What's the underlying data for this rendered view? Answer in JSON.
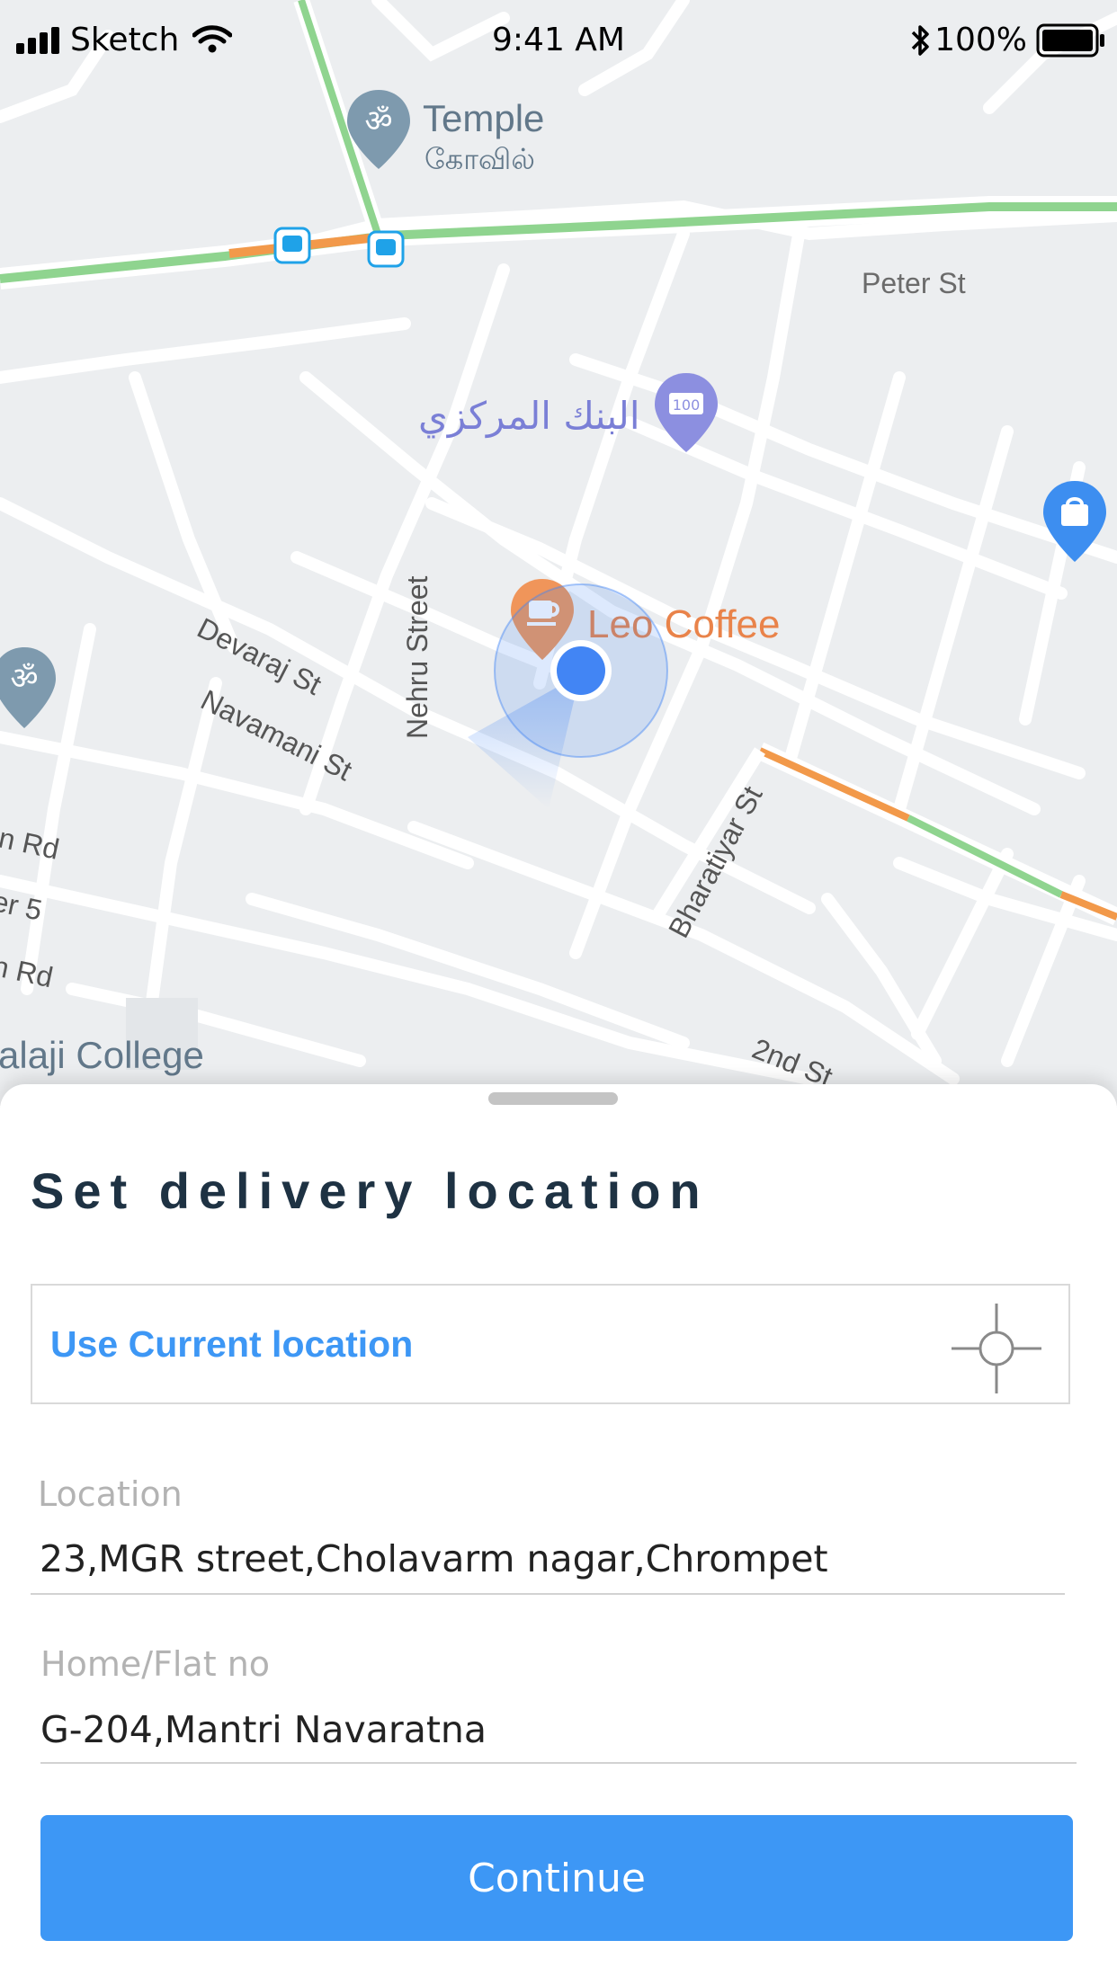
{
  "status_bar": {
    "carrier": "Sketch",
    "time": "9:41 AM",
    "battery": "100%"
  },
  "map": {
    "labels": {
      "temple": "Temple",
      "temple_tamil": "கோவில்",
      "peter_st": "Peter St",
      "central_bank": "البنك المركزي",
      "leo_coffee": "Leo Coffee",
      "devaraj_st": "Devaraj St",
      "navamani_st": "Navamani St",
      "nehru_street": "Nehru Street",
      "bharatiyar_st": "Bharatiyar St",
      "in_rd": "in Rd",
      "er5": "er 5",
      "n_rd": "n Rd",
      "alaji_college": "alaji College",
      "second_st": "2nd St"
    },
    "colors": {
      "road": "#ffffff",
      "traffic_green": "#8fd48f",
      "traffic_orange": "#f2994a",
      "poi_gray": "#7e9aae",
      "poi_purple": "#8c8fe0",
      "poi_blue": "#3d8ef0",
      "poi_orange": "#f0955a",
      "location_dot": "#4285f4"
    }
  },
  "sheet": {
    "title": "Set delivery location",
    "use_current_location": "Use Current location",
    "location_label": "Location",
    "location_value": "23,MGR street,Cholavarm nagar,Chrompet",
    "flat_label": "Home/Flat no",
    "flat_value": "G-204,Mantri Navaratna",
    "continue_label": "Continue"
  }
}
